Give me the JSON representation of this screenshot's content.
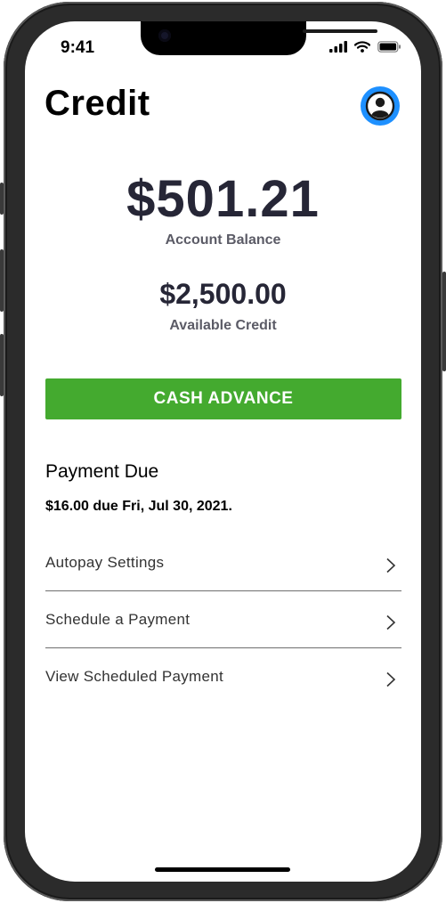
{
  "status_bar": {
    "time": "9:41"
  },
  "header": {
    "title": "Credit",
    "profile_icon": "user-circle-icon"
  },
  "account": {
    "balance": "$501.21",
    "balance_label": "Account Balance",
    "available_credit": "$2,500.00",
    "available_credit_label": "Available Credit"
  },
  "actions": {
    "cash_advance_label": "CASH ADVANCE"
  },
  "payment": {
    "heading": "Payment Due",
    "due_text": "$16.00 due Fri, Jul 30, 2021."
  },
  "menu": {
    "items": [
      {
        "label": "Autopay Settings"
      },
      {
        "label": "Schedule a Payment"
      },
      {
        "label": "View Scheduled Payment"
      }
    ]
  },
  "colors": {
    "accent_green": "#44aa2f",
    "avatar_blue": "#1e90ff",
    "text_dark": "#262636"
  }
}
